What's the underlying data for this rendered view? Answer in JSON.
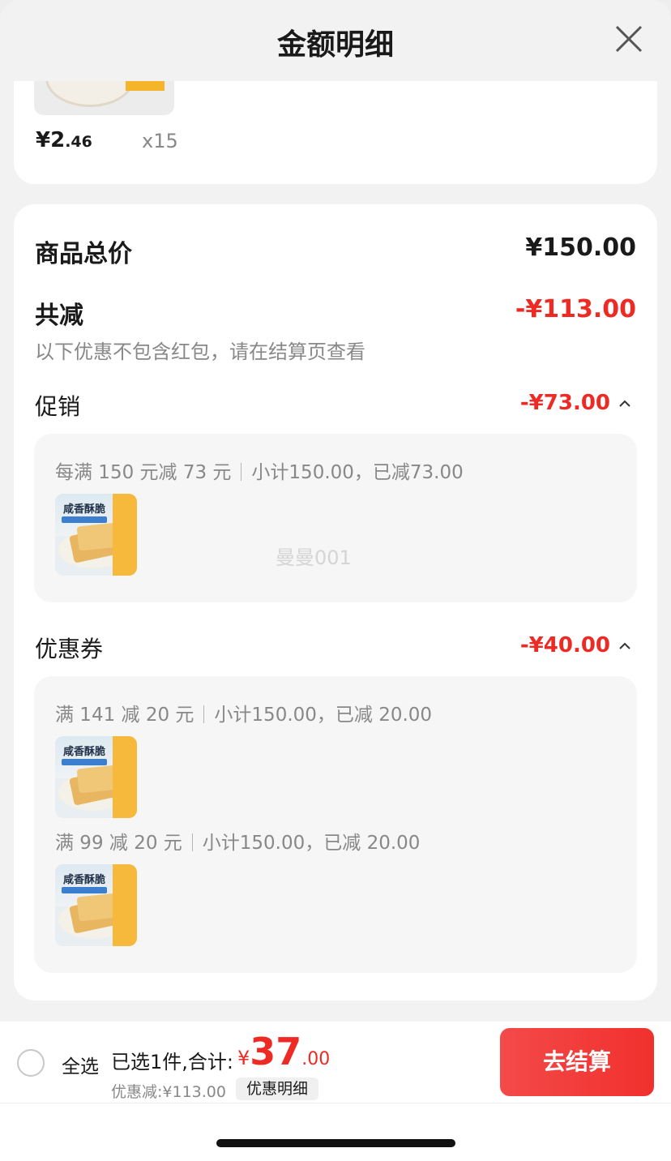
{
  "header": {
    "title": "金额明细",
    "close_icon": "close-icon"
  },
  "top_item": {
    "price_int": "¥2",
    "price_dec": ".46",
    "quantity": "x15"
  },
  "summary": {
    "goods_total_label": "商品总价",
    "goods_total_value": "¥150.00",
    "total_reduction_label": "共减",
    "total_reduction_value": "-¥113.00",
    "note": "以下优惠不包含红包，请在结算页查看"
  },
  "promotion": {
    "label": "促销",
    "value": "-¥73.00",
    "rules": [
      {
        "condition": "每满 150 元减 73 元",
        "subtotal": "小计150.00，已减73.00"
      }
    ]
  },
  "coupon": {
    "label": "优惠券",
    "value": "-¥40.00",
    "rules": [
      {
        "condition": "满 141 减 20 元",
        "subtotal": "小计150.00，已减 20.00"
      },
      {
        "condition": "满 99 减 20 元",
        "subtotal": "小计150.00，已减 20.00"
      }
    ]
  },
  "product_thumb": {
    "title": "咸香酥脆"
  },
  "watermark": "曼曼001",
  "bottom_bar": {
    "select_all": "全选",
    "selected_summary": "已选1件,合计:",
    "currency": "¥",
    "total_int": "37",
    "total_dec": ".00",
    "discount_text": "优惠减:¥113.00",
    "detail_button": "优惠明细",
    "checkout_button": "去结算"
  },
  "colors": {
    "accent_red": "#ee2a24",
    "checkout_gradient_start": "#f34a4a",
    "checkout_gradient_end": "#f1302c"
  }
}
